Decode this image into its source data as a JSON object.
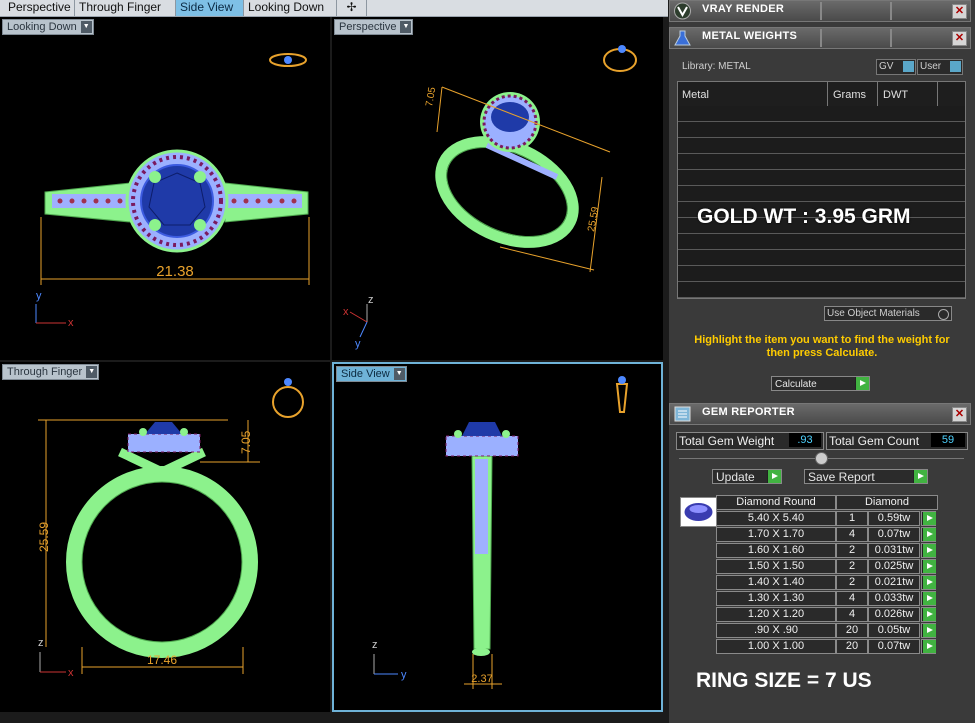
{
  "tabs": [
    {
      "label": "Perspective",
      "active": false
    },
    {
      "label": "Through Finger",
      "active": false
    },
    {
      "label": "Side View",
      "active": true
    },
    {
      "label": "Looking Down",
      "active": false
    },
    {
      "label": "✢",
      "active": false
    }
  ],
  "viewports": {
    "top_left": {
      "label": "Looking Down",
      "dimension": "21.38",
      "axis_a": "y",
      "axis_b": "x"
    },
    "top_right": {
      "label": "Perspective",
      "dim1": "7.05",
      "dim2": "25.59",
      "axis_a": "z",
      "axis_b": "x",
      "axis_c": "y"
    },
    "bottom_left": {
      "label": "Through Finger",
      "dim_height": "25.59",
      "dim_top": "7.05",
      "dim_width": "17.46",
      "axis_a": "z",
      "axis_b": "x"
    },
    "bottom_right": {
      "label": "Side View",
      "dim_width": "2.37",
      "axis_a": "z",
      "axis_b": "y"
    }
  },
  "panel": {
    "vray_title": "VRAY RENDER",
    "metal_title": "METAL WEIGHTS",
    "library_label": "Library: METAL",
    "gv_label": "GV",
    "user_label": "User",
    "metal_columns": [
      "Metal",
      "Grams",
      "DWT"
    ],
    "gold_weight": "GOLD WT : 3.95 GRM",
    "use_object_materials": "Use Object Materials",
    "hint": "Highlight the item you want to find the weight for then press Calculate.",
    "calculate_label": "Calculate",
    "gem_title": "GEM REPORTER",
    "total_gem_weight_label": "Total Gem Weight",
    "total_gem_weight": ".93",
    "total_gem_count_label": "Total Gem Count",
    "total_gem_count": "59",
    "update_label": "Update",
    "save_report_label": "Save Report",
    "gem_header_shape": "Diamond Round",
    "gem_header_type": "Diamond",
    "gems": [
      {
        "size": "5.40 X 5.40",
        "count": "1",
        "weight": "0.59tw"
      },
      {
        "size": "1.70 X 1.70",
        "count": "4",
        "weight": "0.07tw"
      },
      {
        "size": "1.60 X 1.60",
        "count": "2",
        "weight": "0.031tw"
      },
      {
        "size": "1.50 X 1.50",
        "count": "2",
        "weight": "0.025tw"
      },
      {
        "size": "1.40 X 1.40",
        "count": "2",
        "weight": "0.021tw"
      },
      {
        "size": "1.30 X 1.30",
        "count": "4",
        "weight": "0.033tw"
      },
      {
        "size": "1.20 X 1.20",
        "count": "4",
        "weight": "0.026tw"
      },
      {
        "size": ".90 X .90",
        "count": "20",
        "weight": "0.05tw"
      },
      {
        "size": "1.00 X 1.00",
        "count": "20",
        "weight": "0.07tw"
      }
    ],
    "ring_size": "RING SIZE = 7 US"
  },
  "colors": {
    "ring_green": "#8cf28c",
    "gem_blue": "#1f3aa8",
    "dim_orange": "#e8a22c",
    "accent_blue": "#6fb3d8"
  }
}
